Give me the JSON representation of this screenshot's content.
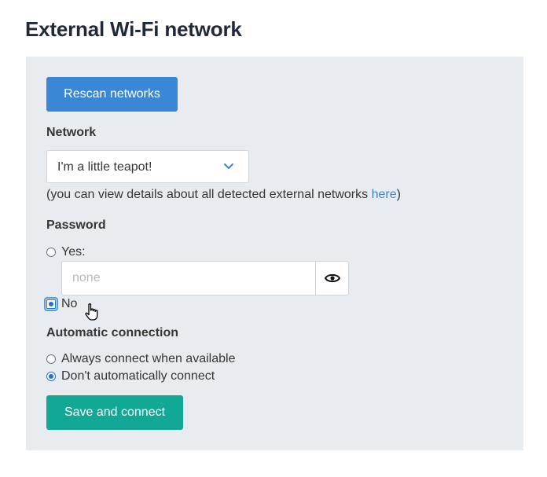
{
  "page_title": "External Wi-Fi network",
  "rescan_button": "Rescan networks",
  "network": {
    "label": "Network",
    "selected": "I'm a little teapot!",
    "note_prefix": "(you can view details about all detected external networks ",
    "note_link": "here",
    "note_suffix": ")"
  },
  "password": {
    "label": "Password",
    "yes_label": "Yes:",
    "placeholder": "none",
    "no_label": "No",
    "selected": "No"
  },
  "automatic_connection": {
    "label": "Automatic connection",
    "always_label": "Always connect when available",
    "dont_label": "Don't automatically connect",
    "selected": "Don't automatically connect"
  },
  "save_button": "Save and connect",
  "colors": {
    "primary": "#3a87d6",
    "success": "#12a896",
    "panel": "#e8ebef",
    "link": "#3a87d6"
  },
  "icons": {
    "dropdown": "chevron-down-icon",
    "toggle_visibility": "eye-icon",
    "pointer": "hand-cursor-icon"
  }
}
